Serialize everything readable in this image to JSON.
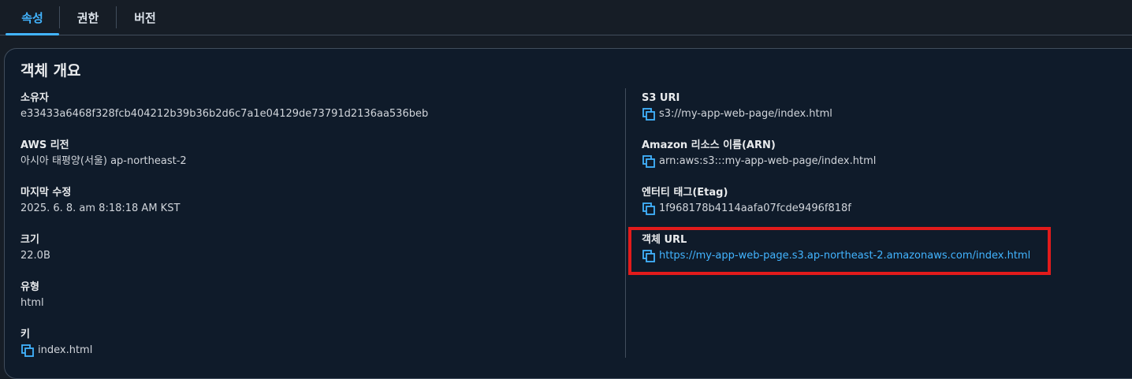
{
  "tabs": [
    {
      "label": "속성",
      "active": true
    },
    {
      "label": "권한",
      "active": false
    },
    {
      "label": "버전",
      "active": false
    }
  ],
  "overview": {
    "title": "객체 개요",
    "left": {
      "owner": {
        "label": "소유자",
        "value": "e33433a6468f328fcb404212b39b36b2d6c7a1e04129de73791d2136aa536beb"
      },
      "region": {
        "label": "AWS 리전",
        "value": "아시아 태평양(서울) ap-northeast-2"
      },
      "modified": {
        "label": "마지막 수정",
        "value": "2025. 6. 8. am 8:18:18 AM KST"
      },
      "size": {
        "label": "크기",
        "value": "22.0B"
      },
      "type": {
        "label": "유형",
        "value": "html"
      },
      "key": {
        "label": "키",
        "value": "index.html"
      }
    },
    "right": {
      "s3uri": {
        "label": "S3 URI",
        "value": "s3://my-app-web-page/index.html"
      },
      "arn": {
        "label": "Amazon 리소스 이름(ARN)",
        "value": "arn:aws:s3:::my-app-web-page/index.html"
      },
      "etag": {
        "label": "엔터티 태그(Etag)",
        "value": "1f968178b4114aafa07fcde9496f818f"
      },
      "url": {
        "label": "객체 URL",
        "value": "https://my-app-web-page.s3.ap-northeast-2.amazonaws.com/index.html"
      }
    }
  },
  "icons": {
    "copy": "copy-icon"
  },
  "colors": {
    "accent": "#42b4ff",
    "highlight": "#e21b1b",
    "background": "#161d26"
  }
}
